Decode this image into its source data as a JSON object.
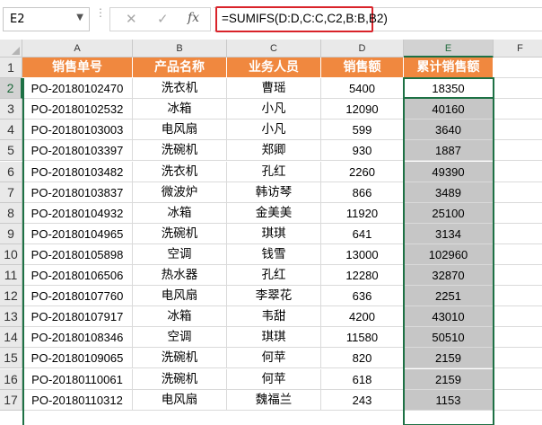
{
  "formula_bar": {
    "name_box": "E2",
    "name_box_arrow": "▼",
    "grip": "⋮",
    "cancel_symbol": "✕",
    "enter_symbol": "✓",
    "fx_symbol": "fx",
    "formula": "=SUMIFS(D:D,C:C,C2,B:B,B2)"
  },
  "accent_colors": {
    "header_fill": "#f0883f",
    "selection_border": "#1e7145",
    "formula_highlight": "#d9232a",
    "selected_fill": "#c6c6c6"
  },
  "columns": [
    "A",
    "B",
    "C",
    "D",
    "E",
    "F"
  ],
  "table": {
    "headers": [
      "销售单号",
      "产品名称",
      "业务人员",
      "销售额",
      "累计销售额"
    ],
    "rows": [
      [
        "PO-20180102470",
        "洗衣机",
        "曹瑶",
        "5400",
        "18350"
      ],
      [
        "PO-20180102532",
        "冰箱",
        "小凡",
        "12090",
        "40160"
      ],
      [
        "PO-20180103003",
        "电风扇",
        "小凡",
        "599",
        "3640"
      ],
      [
        "PO-20180103397",
        "洗碗机",
        "郑卿",
        "930",
        "1887"
      ],
      [
        "PO-20180103482",
        "洗衣机",
        "孔红",
        "2260",
        "49390"
      ],
      [
        "PO-20180103837",
        "微波炉",
        "韩访琴",
        "866",
        "3489"
      ],
      [
        "PO-20180104932",
        "冰箱",
        "金美美",
        "11920",
        "25100"
      ],
      [
        "PO-20180104965",
        "洗碗机",
        "琪琪",
        "641",
        "3134"
      ],
      [
        "PO-20180105898",
        "空调",
        "钱雪",
        "13000",
        "102960"
      ],
      [
        "PO-20180106506",
        "热水器",
        "孔红",
        "12280",
        "32870"
      ],
      [
        "PO-20180107760",
        "电风扇",
        "李翠花",
        "636",
        "2251"
      ],
      [
        "PO-20180107917",
        "冰箱",
        "韦甜",
        "4200",
        "43010"
      ],
      [
        "PO-20180108346",
        "空调",
        "琪琪",
        "11580",
        "50510"
      ],
      [
        "PO-20180109065",
        "洗碗机",
        "何苹",
        "820",
        "2159"
      ],
      [
        "PO-20180110061",
        "洗碗机",
        "何苹",
        "618",
        "2159"
      ],
      [
        "PO-20180110312",
        "电风扇",
        "魏福兰",
        "243",
        "1153"
      ]
    ]
  },
  "row_numbers": [
    "1",
    "2",
    "3",
    "4",
    "5",
    "6",
    "7",
    "8",
    "9",
    "10",
    "11",
    "12",
    "13",
    "14",
    "15",
    "16",
    "17"
  ],
  "active_cell": "E2"
}
